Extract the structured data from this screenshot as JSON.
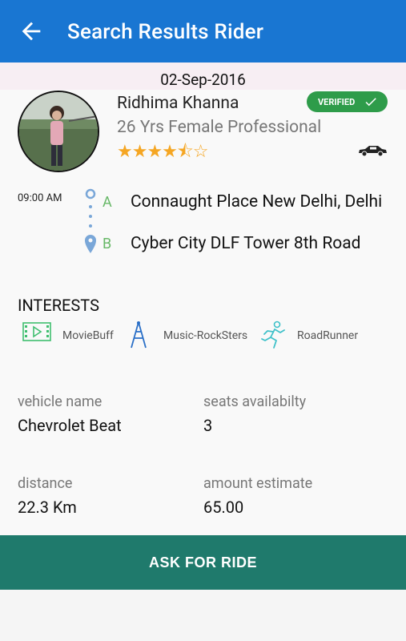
{
  "appbar": {
    "title": "Search Results Rider"
  },
  "trip": {
    "date": "02-Sep-2016",
    "time": "09:00 AM"
  },
  "rider": {
    "name": "Ridhima Khanna",
    "meta": "26 Yrs Female Professional",
    "rating_stars": "★★★★⯪☆",
    "rating": 4.5,
    "rating_max": 5,
    "verified_label": "VERIFIED"
  },
  "route": {
    "from_letter": "A",
    "from": "Connaught Place New Delhi, Delhi",
    "to_letter": "B",
    "to": "Cyber City DLF Tower 8th Road"
  },
  "interests": {
    "title": "INTERESTS",
    "items": [
      {
        "label": "MovieBuff",
        "icon": "film-icon"
      },
      {
        "label": "Music-RockSters",
        "icon": "tower-icon"
      },
      {
        "label": "RoadRunner",
        "icon": "runner-icon"
      }
    ]
  },
  "details": {
    "vehicle_label": "vehicle name",
    "vehicle_value": "Chevrolet Beat",
    "seats_label": "seats availabilty",
    "seats_value": "3",
    "distance_label": "distance",
    "distance_value": "22.3 Km",
    "amount_label": "amount estimate",
    "amount_value": "65.00"
  },
  "actions": {
    "ask_label": "ASK FOR RIDE"
  },
  "colors": {
    "appbar": "#1976d2",
    "verified": "#2e9c4a",
    "button": "#1f7a6c",
    "star": "#f5a623",
    "route_pin": "#7aa7d8",
    "route_letter": "#68b868"
  }
}
